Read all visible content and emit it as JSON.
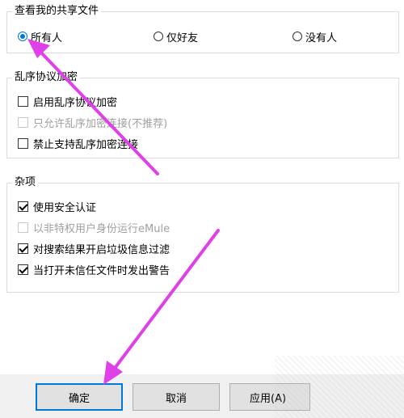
{
  "share_group": {
    "title": "查看我的共享文件",
    "options": [
      {
        "label": "所有人",
        "selected": true
      },
      {
        "label": "仅好友",
        "selected": false
      },
      {
        "label": "没有人",
        "selected": false
      }
    ]
  },
  "obfuscation_group": {
    "title": "乱序协议加密",
    "items": [
      {
        "label": "启用乱序协议加密",
        "checked": false,
        "disabled": false
      },
      {
        "label": "只允许乱序加密连接(不推荐)",
        "checked": false,
        "disabled": true
      },
      {
        "label": "禁止支持乱序加密连接",
        "checked": false,
        "disabled": false
      }
    ]
  },
  "misc_group": {
    "title": "杂项",
    "items": [
      {
        "label": "使用安全认证",
        "checked": true,
        "disabled": false
      },
      {
        "label": "以非特权用户身份运行eMule",
        "checked": false,
        "disabled": true
      },
      {
        "label": "对搜索结果开启垃圾信息过滤",
        "checked": true,
        "disabled": false
      },
      {
        "label": "当打开未信任文件时发出警告",
        "checked": true,
        "disabled": false
      }
    ]
  },
  "buttons": {
    "ok": "确定",
    "cancel": "取消",
    "apply": "应用(A)"
  },
  "colors": {
    "accent": "#0078d7",
    "annotation_arrow": "#e040e8"
  }
}
